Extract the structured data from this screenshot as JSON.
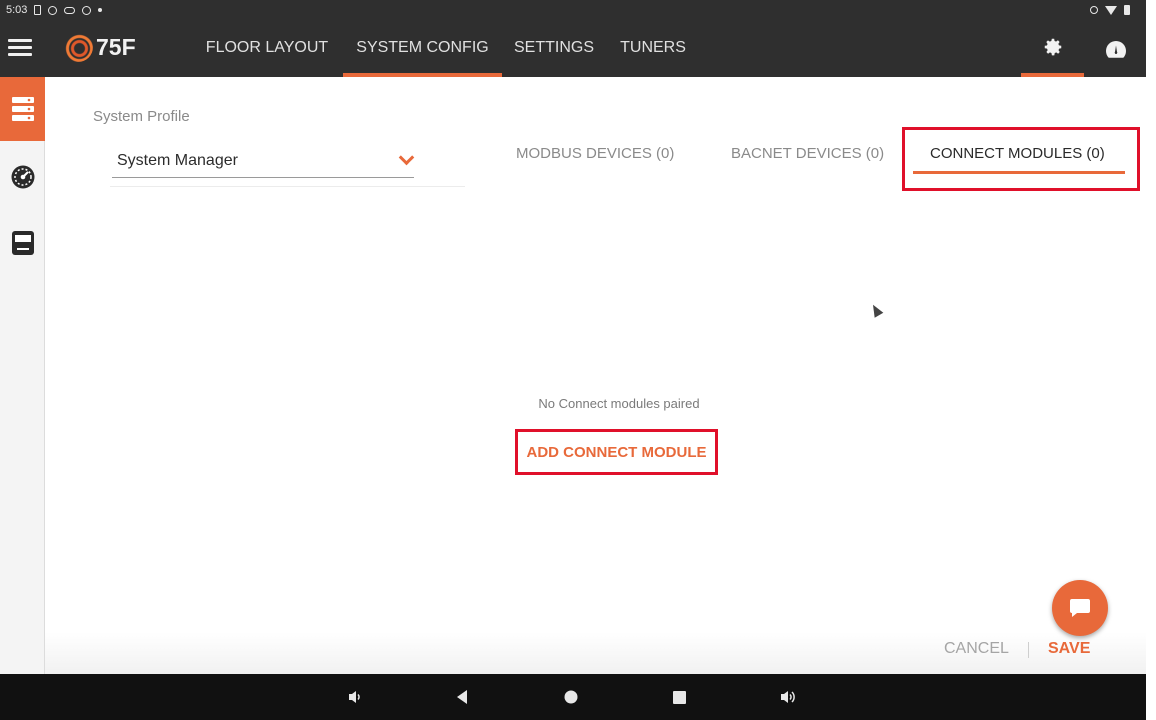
{
  "status_bar": {
    "time": "5:03"
  },
  "app_bar": {
    "logo_text": "75F",
    "tabs": [
      {
        "label": "FLOOR LAYOUT"
      },
      {
        "label": "SYSTEM CONFIG",
        "active": true
      },
      {
        "label": "SETTINGS"
      },
      {
        "label": "TUNERS"
      }
    ],
    "icons": [
      "menu-icon",
      "gear-icon",
      "dashboard-icon"
    ]
  },
  "left_rail": {
    "items": [
      {
        "icon": "system-icon",
        "active": true
      },
      {
        "icon": "gauge-icon"
      },
      {
        "icon": "thermostat-icon"
      }
    ]
  },
  "profile": {
    "label": "System Profile",
    "value": "System Manager"
  },
  "device_tabs": {
    "modbus": "MODBUS DEVICES (0)",
    "bacnet": "BACNET DEVICES (0)",
    "connect": "CONNECT MODULES (0)",
    "active": "connect"
  },
  "empty_state": {
    "message": "No Connect modules paired",
    "action": "ADD CONNECT MODULE"
  },
  "footer": {
    "cancel": "CANCEL",
    "separator": "|",
    "save": "SAVE"
  },
  "colors": {
    "accent": "#e8693a",
    "appbar": "#2f2f2f",
    "highlight": "#e0102a"
  },
  "nav_bar": {
    "keys": [
      "volume-down-icon",
      "back-icon",
      "home-icon",
      "recents-icon",
      "volume-up-icon"
    ]
  }
}
